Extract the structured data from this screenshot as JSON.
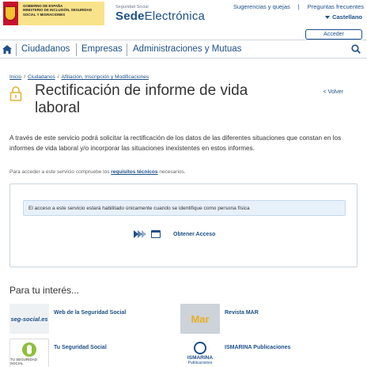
{
  "header": {
    "gov_lines": [
      "Gobierno de España",
      "Ministerio de Inclusión, Seguridad Social y Migraciones"
    ],
    "sede_small": "Seguridad Social",
    "sede_bold": "Sede",
    "sede_rest": "Electrónica",
    "links": [
      "Sugerencias y quejas",
      "Preguntas frecuentes"
    ],
    "language": "Castellano",
    "login_label": "Acceder"
  },
  "nav": {
    "items": [
      "Ciudadanos",
      "Empresas",
      "Administraciones y Mutuas"
    ]
  },
  "breadcrumb": [
    "Inicio",
    "Ciudadanos",
    "Afiliación, Inscripción y Modificaciones"
  ],
  "page": {
    "title": "Rectificación de informe de vida laboral",
    "back_label": "< Volver",
    "intro": "A través de este servicio podrá solicitar la rectificación de los datos de las diferentes situaciones que constan en los informes de vida laboral y/o incorporar las situaciones inexistentes en estos informes.",
    "req_prefix": "Para acceder a este servicio compruebe los ",
    "req_link": "requisitos técnicos",
    "req_suffix": " necesarios."
  },
  "access": {
    "info": "El acceso a este servicio estará habilitado únicamente cuando se identifique como persona física",
    "button_label": "Obtener Acceso"
  },
  "interest": {
    "title": "Para tu interés...",
    "tiles": [
      {
        "label": "Web de la Seguridad Social",
        "thumb_text": "seg-social.es"
      },
      {
        "label": "Revista MAR",
        "thumb_text": "Mar"
      },
      {
        "label": "Tu Seguridad Social",
        "thumb_text": "TU SEGURIDAD SOCIAL"
      },
      {
        "label": "ISMARINA Publicaciones",
        "thumb_text": "ISMARINA",
        "thumb_sub": "Publicaciones"
      }
    ]
  },
  "colors": {
    "brand_blue": "#1b4f8a",
    "info_bg": "#e8f1fa"
  }
}
